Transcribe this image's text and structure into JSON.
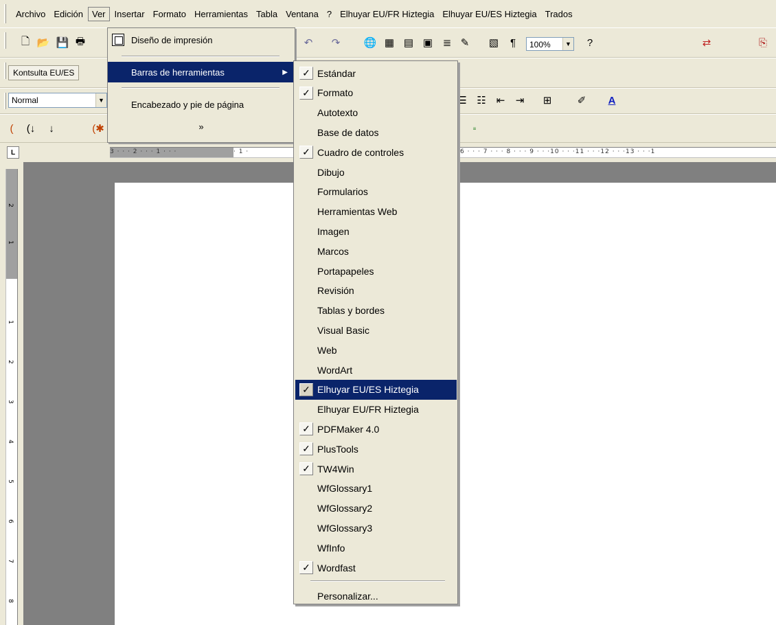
{
  "menubar": {
    "items": [
      {
        "label": "Archivo"
      },
      {
        "label": "Edición"
      },
      {
        "label": "Ver"
      },
      {
        "label": "Insertar"
      },
      {
        "label": "Formato"
      },
      {
        "label": "Herramientas"
      },
      {
        "label": "Tabla"
      },
      {
        "label": "Ventana"
      },
      {
        "label": "?"
      },
      {
        "label": "Elhuyar EU/FR Hiztegia"
      },
      {
        "label": "Elhuyar EU/ES Hiztegia"
      },
      {
        "label": "Trados"
      }
    ]
  },
  "toolbar": {
    "zoom": "100%",
    "style": "Normal",
    "kontsulta": "Kontsulta EU/ES"
  },
  "ruler": {
    "tab_marker": "L",
    "h_left": "3 · · · 2 · · · 1 · · · ",
    "h_right": "· 1 · ",
    "h_right2": "6 · · · 7 · · · 8 · · · 9 · · ·10 · · ·11 · · ·12 · · ·13 · · ·1",
    "v_labels": [
      "2",
      "1",
      "1",
      "2",
      "3",
      "4",
      "5",
      "6",
      "7",
      "8"
    ]
  },
  "ver_menu": {
    "items": [
      {
        "label": "Diseño de impresión"
      },
      {
        "label": "Barras de herramientas"
      },
      {
        "label": "Encabezado y pie de página"
      }
    ],
    "more": "»"
  },
  "toolbars_menu": {
    "items": [
      {
        "label": "Estándar",
        "checked": true
      },
      {
        "label": "Formato",
        "checked": true
      },
      {
        "label": "Autotexto",
        "checked": false
      },
      {
        "label": "Base de datos",
        "checked": false
      },
      {
        "label": "Cuadro de controles",
        "checked": true
      },
      {
        "label": "Dibujo",
        "checked": false
      },
      {
        "label": "Formularios",
        "checked": false
      },
      {
        "label": "Herramientas Web",
        "checked": false
      },
      {
        "label": "Imagen",
        "checked": false
      },
      {
        "label": "Marcos",
        "checked": false
      },
      {
        "label": "Portapapeles",
        "checked": false
      },
      {
        "label": "Revisión",
        "checked": false
      },
      {
        "label": "Tablas y bordes",
        "checked": false
      },
      {
        "label": "Visual Basic",
        "checked": false
      },
      {
        "label": "Web",
        "checked": false
      },
      {
        "label": "WordArt",
        "checked": false
      },
      {
        "label": "Elhuyar EU/ES Hiztegia",
        "checked": true,
        "highlighted": true
      },
      {
        "label": "Elhuyar EU/FR Hiztegia",
        "checked": false
      },
      {
        "label": "PDFMaker 4.0",
        "checked": true
      },
      {
        "label": "PlusTools",
        "checked": true
      },
      {
        "label": "TW4Win",
        "checked": true
      },
      {
        "label": "WfGlossary1",
        "checked": false
      },
      {
        "label": "WfGlossary2",
        "checked": false
      },
      {
        "label": "WfGlossary3",
        "checked": false
      },
      {
        "label": "WfInfo",
        "checked": false
      },
      {
        "label": "Wordfast",
        "checked": true
      }
    ],
    "customize": "Personalizar...",
    "check_glyph": "✓",
    "highlight_color": "#0a246a"
  }
}
